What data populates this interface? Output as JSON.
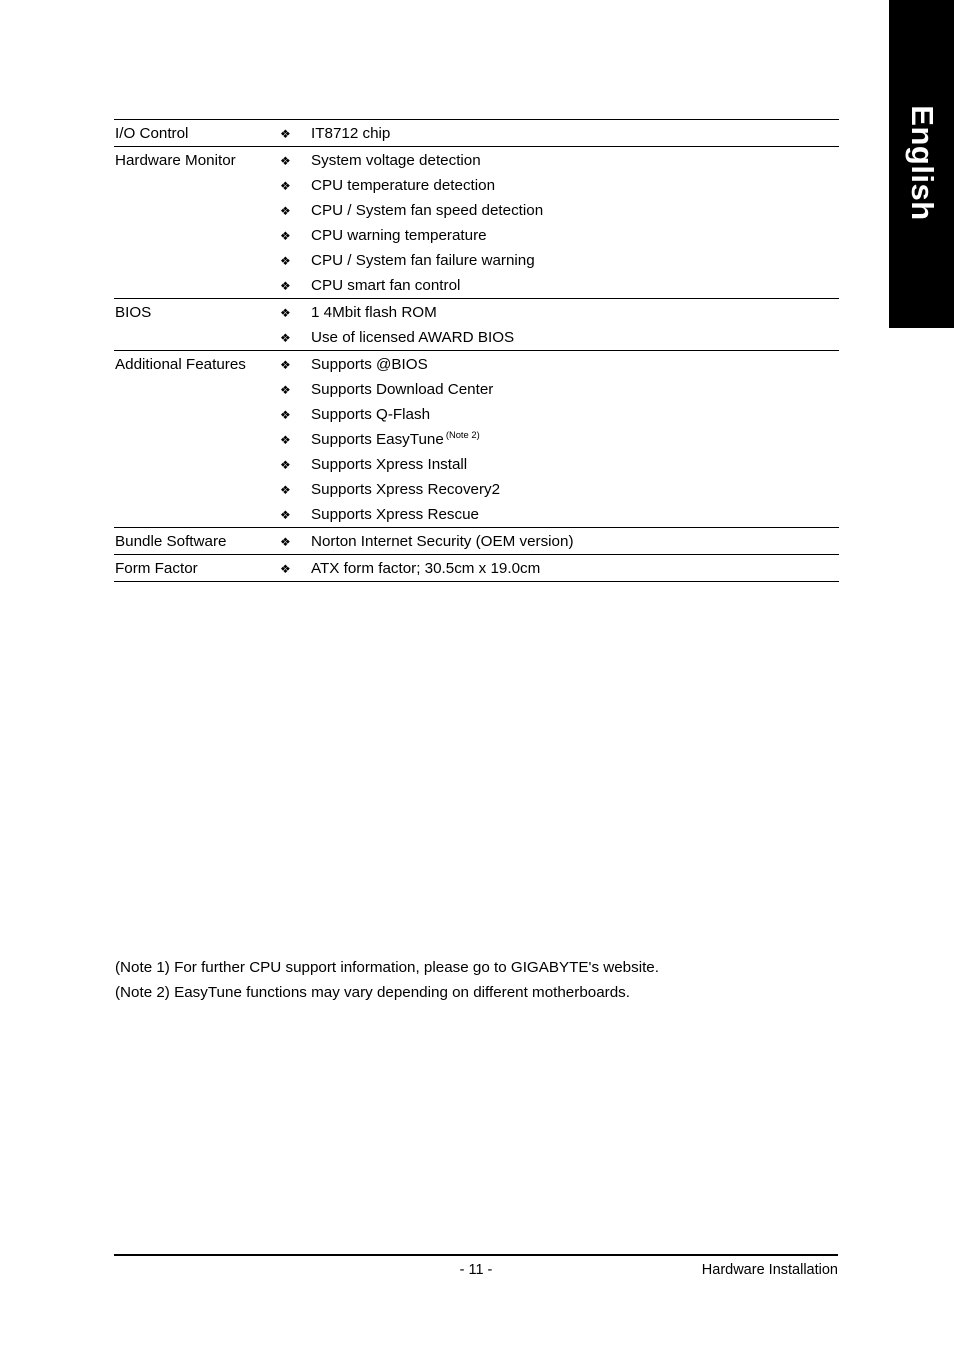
{
  "language_tab": {
    "label": "English"
  },
  "spec_table": {
    "rows": [
      {
        "category": "I/O Control",
        "items": [
          {
            "text": "IT8712 chip",
            "note": ""
          }
        ]
      },
      {
        "category": "Hardware Monitor",
        "items": [
          {
            "text": "System voltage detection",
            "note": ""
          },
          {
            "text": "CPU temperature detection",
            "note": ""
          },
          {
            "text": "CPU / System fan speed detection",
            "note": ""
          },
          {
            "text": "CPU warning temperature",
            "note": ""
          },
          {
            "text": "CPU / System fan failure warning",
            "note": ""
          },
          {
            "text": "CPU smart fan control",
            "note": ""
          }
        ]
      },
      {
        "category": "BIOS",
        "items": [
          {
            "text": "1 4Mbit flash ROM",
            "note": ""
          },
          {
            "text": "Use of licensed AWARD BIOS",
            "note": ""
          }
        ]
      },
      {
        "category": "Additional Features",
        "items": [
          {
            "text": "Supports @BIOS",
            "note": ""
          },
          {
            "text": "Supports Download Center",
            "note": ""
          },
          {
            "text": "Supports Q-Flash",
            "note": ""
          },
          {
            "text": "Supports EasyTune",
            "note": "(Note 2)"
          },
          {
            "text": "Supports Xpress Install",
            "note": ""
          },
          {
            "text": "Supports Xpress Recovery2",
            "note": ""
          },
          {
            "text": "Supports Xpress Rescue",
            "note": ""
          }
        ]
      },
      {
        "category": "Bundle Software",
        "items": [
          {
            "text": "Norton Internet Security (OEM version)",
            "note": ""
          }
        ]
      },
      {
        "category": "Form Factor",
        "items": [
          {
            "text": "ATX form factor; 30.5cm x 19.0cm",
            "note": ""
          }
        ]
      }
    ],
    "bullet_glyph": "❖"
  },
  "notes": [
    "(Note 1) For further CPU support information, please go to GIGABYTE's website.",
    "(Note 2) EasyTune functions may vary depending on different motherboards."
  ],
  "footer": {
    "page_number": "- 11 -",
    "section_title": "Hardware Installation"
  }
}
